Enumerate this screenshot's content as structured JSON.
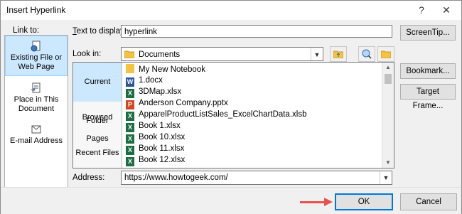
{
  "window": {
    "title": "Insert Hyperlink",
    "help_label": "?",
    "close_label": "✕"
  },
  "link_to": {
    "label": "Link to:",
    "items": [
      {
        "label": "Existing File or Web Page"
      },
      {
        "label": "Place in This Document"
      },
      {
        "label": "E-mail Address"
      }
    ]
  },
  "text_to_display": {
    "label": "Text to display:",
    "value": "hyperlink"
  },
  "screentip_button": "ScreenTip...",
  "look_in": {
    "label": "Look in:",
    "value": "Documents"
  },
  "browse_nav": {
    "items": [
      {
        "label": "Current Folder"
      },
      {
        "label": "Browsed Pages"
      },
      {
        "label": "Recent Files"
      }
    ]
  },
  "files": [
    {
      "name": "My New Notebook",
      "type": "folder"
    },
    {
      "name": "1.docx",
      "type": "word"
    },
    {
      "name": "3DMap.xlsx",
      "type": "excel"
    },
    {
      "name": "Anderson Company.pptx",
      "type": "powerpoint"
    },
    {
      "name": "ApparelProductListSales_ExcelChartData.xlsb",
      "type": "excel"
    },
    {
      "name": "Book 1.xlsx",
      "type": "excel"
    },
    {
      "name": "Book 10.xlsx",
      "type": "excel"
    },
    {
      "name": "Book 11.xlsx",
      "type": "excel"
    },
    {
      "name": "Book 12.xlsx",
      "type": "excel"
    }
  ],
  "right_buttons": {
    "bookmark": "Bookmark...",
    "target_frame": "Target Frame..."
  },
  "address": {
    "label": "Address:",
    "value": "https://www.howtogeek.com/"
  },
  "footer": {
    "ok": "OK",
    "cancel": "Cancel"
  },
  "colors": {
    "selection": "#cce8ff",
    "excel": "#1d6f42",
    "word": "#2b579a",
    "powerpoint": "#d24726",
    "folder": "#f5c342",
    "annotation_arrow": "#e8524a"
  }
}
